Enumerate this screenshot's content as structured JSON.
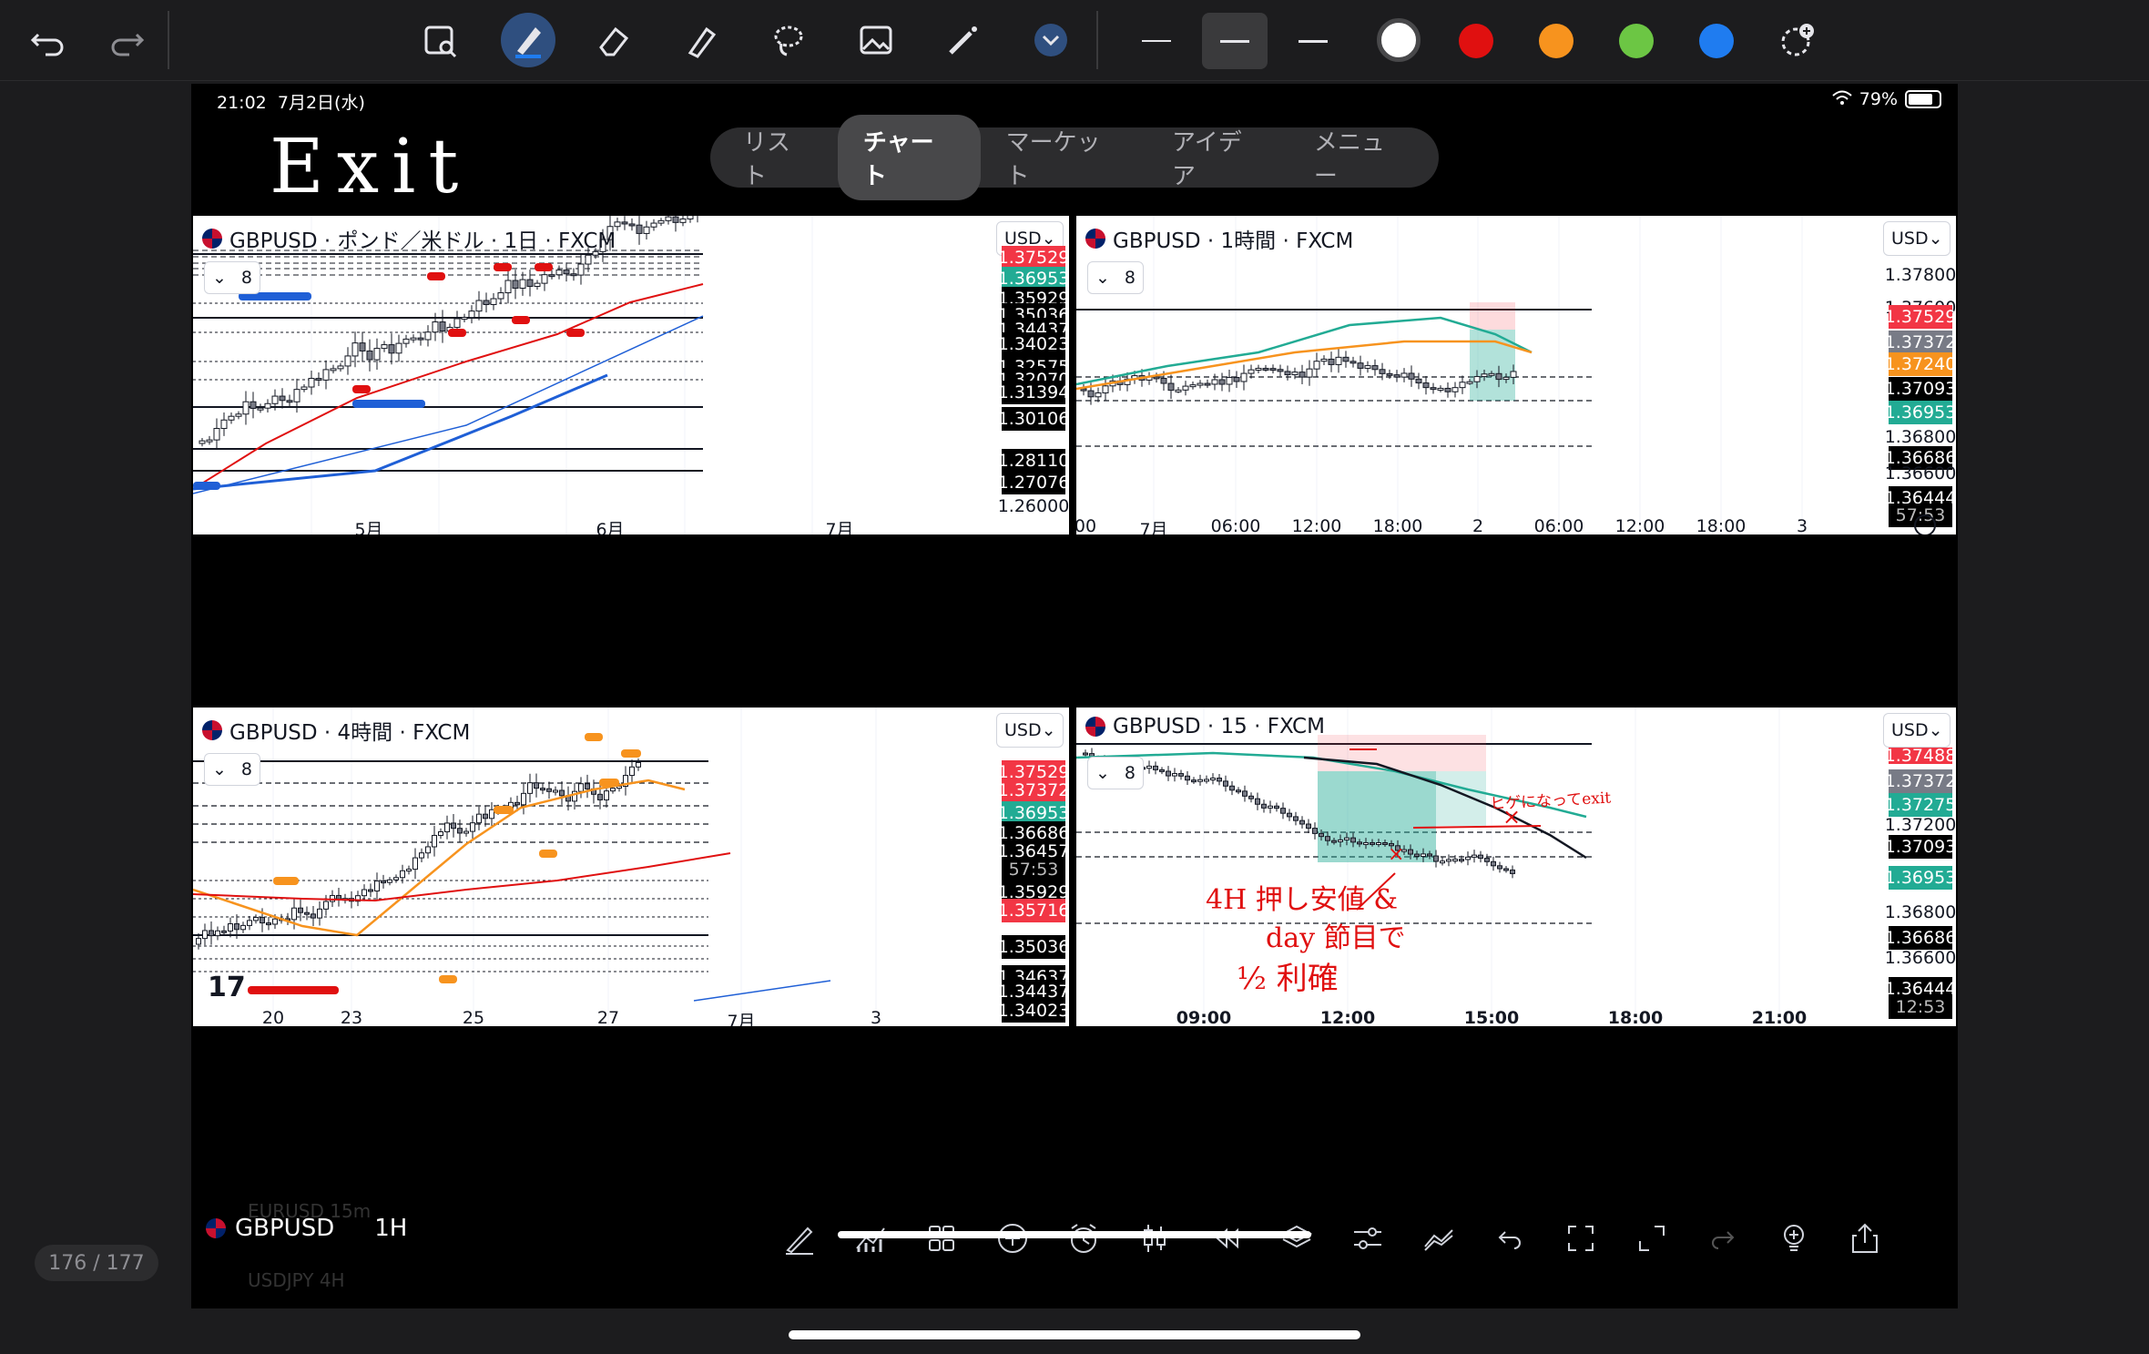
{
  "app": {
    "page_counter": "176 / 177",
    "toolbar": {
      "colors": [
        "#ffffff",
        "#e01010",
        "#f7931e",
        "#6cc644",
        "#1f7cf0"
      ],
      "icons": [
        "undo-icon",
        "redo-icon",
        "image-search-icon",
        "pen-icon",
        "eraser-icon",
        "highlighter-icon",
        "lasso-icon",
        "image-icon",
        "magic-wand-icon",
        "chevron-down-icon",
        "add-color-icon"
      ]
    }
  },
  "status_bar": {
    "time": "21:02",
    "date": "7月2日(水)",
    "battery": "79%"
  },
  "handwritten_title": "Exit",
  "nav": {
    "tabs": [
      "リスト",
      "チャート",
      "マーケット",
      "アイデア",
      "メニュー"
    ],
    "active": "チャート"
  },
  "panes": [
    {
      "id": "daily",
      "title": "GBPUSD · ポンド／米ドル · 1日 · FXCM",
      "currency": "USD",
      "ma_count": "8",
      "price_labels": [
        {
          "text": "1.37529",
          "style": "red"
        },
        {
          "text": "1.36953",
          "style": "teal"
        },
        {
          "text": "1.35929",
          "style": "black"
        },
        {
          "text": "1.35036",
          "style": "black"
        },
        {
          "text": "1.34437",
          "style": "black"
        },
        {
          "text": "1.34023",
          "style": "black"
        },
        {
          "text": "1.32575",
          "style": "black"
        },
        {
          "text": "1.32070",
          "style": "black"
        },
        {
          "text": "1.31394",
          "style": "black"
        },
        {
          "text": "1.30106",
          "style": "black"
        },
        {
          "text": "1.28110",
          "style": "black"
        },
        {
          "text": "1.27076",
          "style": "black"
        },
        {
          "text": "1.26000",
          "style": "plain"
        }
      ],
      "time_labels": [
        "5月",
        "6月",
        "7月"
      ]
    },
    {
      "id": "h1",
      "title": "GBPUSD · 1時間 · FXCM",
      "currency": "USD",
      "ma_count": "8",
      "price_labels": [
        {
          "text": "1.37800",
          "style": "plain"
        },
        {
          "text": "1.37600",
          "style": "plain"
        },
        {
          "text": "1.37529",
          "style": "red"
        },
        {
          "text": "1.37372",
          "style": "gray"
        },
        {
          "text": "1.37240",
          "style": "orange"
        },
        {
          "text": "1.37093",
          "style": "black"
        },
        {
          "text": "1.36953",
          "style": "teal"
        },
        {
          "text": "1.36800",
          "style": "plain"
        },
        {
          "text": "1.36686",
          "style": "black"
        },
        {
          "text": "1.36600",
          "style": "plain"
        },
        {
          "text": "1.36444",
          "style": "black"
        },
        {
          "text": "57:53",
          "style": "black"
        }
      ],
      "time_labels": [
        "00",
        "7月",
        "06:00",
        "12:00",
        "18:00",
        "2",
        "06:00",
        "12:00",
        "18:00",
        "3"
      ]
    },
    {
      "id": "h4",
      "title": "GBPUSD · 4時間 · FXCM",
      "currency": "USD",
      "ma_count": "8",
      "price_labels": [
        {
          "text": "1.37529",
          "style": "red"
        },
        {
          "text": "1.37372",
          "style": "black"
        },
        {
          "text": "1.36953",
          "style": "teal"
        },
        {
          "text": "1.36686",
          "style": "black"
        },
        {
          "text": "1.36457",
          "style": "black"
        },
        {
          "text": "57:53",
          "style": "black"
        },
        {
          "text": "1.35929",
          "style": "black"
        },
        {
          "text": "1.35716",
          "style": "red"
        },
        {
          "text": "1.35036",
          "style": "black"
        },
        {
          "text": "1.34637",
          "style": "black"
        },
        {
          "text": "1.34437",
          "style": "black"
        },
        {
          "text": "1.34023",
          "style": "black"
        }
      ],
      "time_labels": [
        "20",
        "23",
        "25",
        "27",
        "7月",
        "3"
      ]
    },
    {
      "id": "m15",
      "title": "GBPUSD · 15 · FXCM",
      "currency": "USD",
      "ma_count": "8",
      "price_labels": [
        {
          "text": "1.37488",
          "style": "red"
        },
        {
          "text": "1.37372",
          "style": "gray"
        },
        {
          "text": "1.37275",
          "style": "teal"
        },
        {
          "text": "1.37200",
          "style": "plain"
        },
        {
          "text": "1.37093",
          "style": "black"
        },
        {
          "text": "1.36953",
          "style": "teal"
        },
        {
          "text": "1.36800",
          "style": "plain"
        },
        {
          "text": "1.36686",
          "style": "black"
        },
        {
          "text": "1.36600",
          "style": "plain"
        },
        {
          "text": "1.36444",
          "style": "black"
        },
        {
          "text": "12:53",
          "style": "black"
        }
      ],
      "time_labels": [
        "09:00",
        "12:00",
        "15:00",
        "18:00",
        "21:00"
      ],
      "annotations": {
        "note1": "4H 押し安値 &",
        "note2": "day 節目で",
        "note3": "½ 利確",
        "note_small": "ヒゲになってexit"
      }
    }
  ],
  "bottom_bar": {
    "symbol": "GBPUSD",
    "interval": "1H",
    "ghost_rows": [
      "EURUSD  15m",
      "USDJPY  4H"
    ]
  }
}
